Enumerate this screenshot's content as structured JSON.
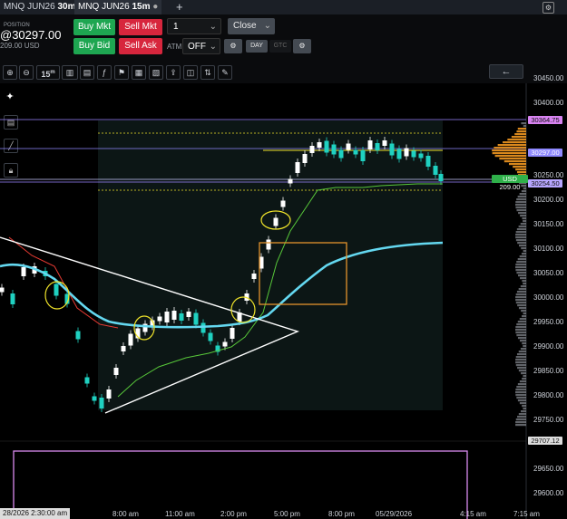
{
  "tabs": [
    {
      "label_a": "MNQ JUN26",
      "label_b": "30",
      "suffix": "m"
    },
    {
      "label_a": "MNQ JUN26",
      "label_b": "15",
      "suffix": "m"
    },
    {
      "add": "+"
    }
  ],
  "position": {
    "label": "POSITION",
    "price": "@30297.00",
    "sub": "209.00 USD"
  },
  "order": {
    "buy_mkt": "Buy Mkt",
    "sell_mkt": "Sell Mkt",
    "buy_bid": "Buy Bid",
    "sell_ask": "Sell Ask",
    "qty": "1",
    "close": "Close",
    "atm_label": "ATM",
    "atm_value": "OFF",
    "tif_day": "DAY",
    "tif_gtc": "GTC"
  },
  "toolbar": {
    "interval": "15",
    "interval_suffix": "m",
    "back_arrow": "←"
  },
  "price_axis": {
    "labels": [
      "30450.00",
      "30400.00",
      "30250.00",
      "30200.00",
      "30150.00",
      "30100.00",
      "30050.00",
      "30000.00",
      "29950.00",
      "29900.00",
      "29850.00",
      "29800.00",
      "29750.00",
      "29650.00",
      "29600.00"
    ],
    "tag_top": "30364.75",
    "tag_mid": "30297.00",
    "tag_low": "30254.50",
    "tag_usd": "USD 209.00",
    "tag_bottom": "29707.12"
  },
  "time_axis": {
    "current": "28/2026 2:30:00 am",
    "labels": [
      "8:00 am",
      "11:00 am",
      "2:00 pm",
      "5:00 pm",
      "8:00 pm",
      "05/29/2026",
      "4:15 am",
      "7:15 am"
    ]
  },
  "colors": {
    "up": "#ffffff",
    "down": "#1fd1c1",
    "vwap": "#64d8f0",
    "trend": "#ffffff",
    "box": "#e3932d",
    "yellow": "#f0e42a",
    "violet": "#9b86ff",
    "green_line": "#58c83a",
    "red_line": "#e63a32",
    "profile": "#e58f1f"
  }
}
